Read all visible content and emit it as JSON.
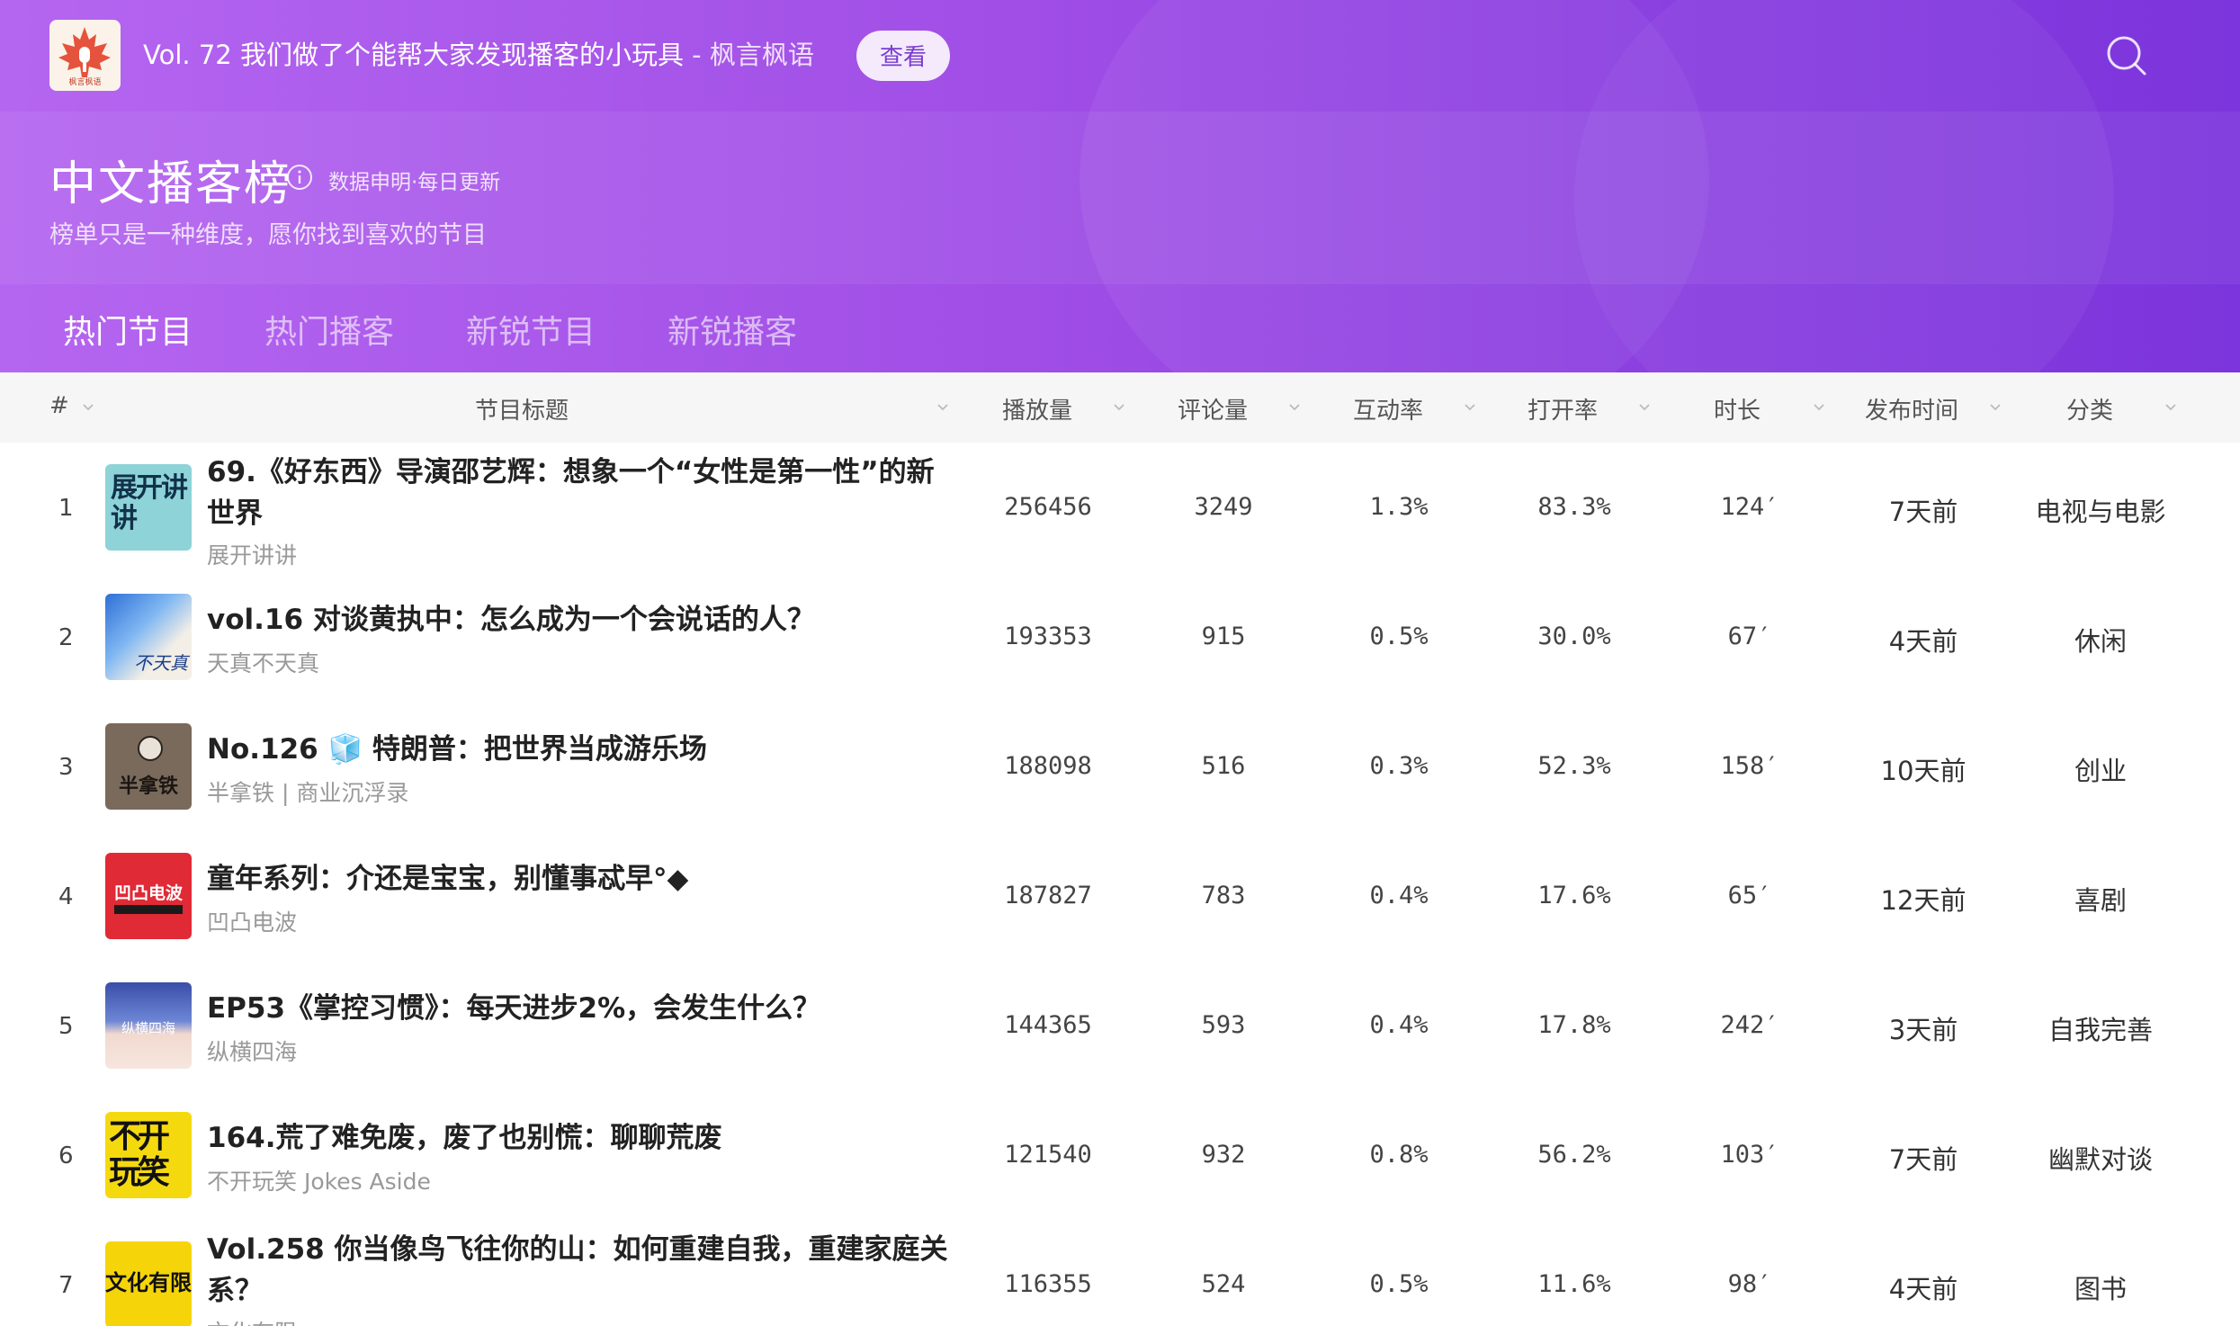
{
  "topbar": {
    "logo_text": "枫言枫语",
    "announcement": "Vol. 72 我们做了个能帮大家发现播客的小玩具",
    "announcement_source": "- 枫言枫语",
    "view_button": "查看"
  },
  "header": {
    "title": "中文播客榜",
    "data_note": "数据申明·每日更新",
    "subtitle": "榜单只是一种维度，愿你找到喜欢的节目"
  },
  "tabs": [
    {
      "label": "热门节目",
      "active": true
    },
    {
      "label": "热门播客",
      "active": false
    },
    {
      "label": "新锐节目",
      "active": false
    },
    {
      "label": "新锐播客",
      "active": false
    }
  ],
  "table": {
    "columns": [
      "#",
      "节目标题",
      "播放量",
      "评论量",
      "互动率",
      "打开率",
      "时长",
      "发布时间",
      "分类"
    ],
    "rows": [
      {
        "rank": "1",
        "title": "69.《好东西》导演邵艺辉：想象一个“女性是第一性”的新世界",
        "podcast": "展开讲讲",
        "plays": "256456",
        "comments": "3249",
        "interaction": "1.3%",
        "open_rate": "83.3%",
        "duration": "124′",
        "published": "7天前",
        "category": "电视与电影",
        "cover_text": "展开讲讲"
      },
      {
        "rank": "2",
        "title": "vol.16 对谈黄执中：怎么成为一个会说话的人？",
        "podcast": "天真不天真",
        "plays": "193353",
        "comments": "915",
        "interaction": "0.5%",
        "open_rate": "30.0%",
        "duration": "67′",
        "published": "4天前",
        "category": "休闲",
        "cover_text": "不天真"
      },
      {
        "rank": "3",
        "title": "No.126 🧊 特朗普：把世界当成游乐场",
        "podcast": "半拿铁 | 商业沉浮录",
        "plays": "188098",
        "comments": "516",
        "interaction": "0.3%",
        "open_rate": "52.3%",
        "duration": "158′",
        "published": "10天前",
        "category": "创业",
        "cover_text": "半拿铁"
      },
      {
        "rank": "4",
        "title": "童年系列：介还是宝宝，别懂事忒早°◆",
        "podcast": "凹凸电波",
        "plays": "187827",
        "comments": "783",
        "interaction": "0.4%",
        "open_rate": "17.6%",
        "duration": "65′",
        "published": "12天前",
        "category": "喜剧",
        "cover_text": "凹凸电波"
      },
      {
        "rank": "5",
        "title": "EP53《掌控习惯》：每天进步2%，会发生什么？",
        "podcast": "纵横四海",
        "plays": "144365",
        "comments": "593",
        "interaction": "0.4%",
        "open_rate": "17.8%",
        "duration": "242′",
        "published": "3天前",
        "category": "自我完善",
        "cover_text": "纵横四海"
      },
      {
        "rank": "6",
        "title": "164.荒了难免废，废了也别慌：聊聊荒废",
        "podcast": "不开玩笑 Jokes Aside",
        "plays": "121540",
        "comments": "932",
        "interaction": "0.8%",
        "open_rate": "56.2%",
        "duration": "103′",
        "published": "7天前",
        "category": "幽默对谈",
        "cover_text": "不开玩笑"
      },
      {
        "rank": "7",
        "title": "Vol.258 你当像鸟飞往你的山：如何重建自我，重建家庭关系？",
        "podcast": "文化有限",
        "plays": "116355",
        "comments": "524",
        "interaction": "0.5%",
        "open_rate": "11.6%",
        "duration": "98′",
        "published": "4天前",
        "category": "图书",
        "cover_text": "文化有限"
      }
    ]
  }
}
